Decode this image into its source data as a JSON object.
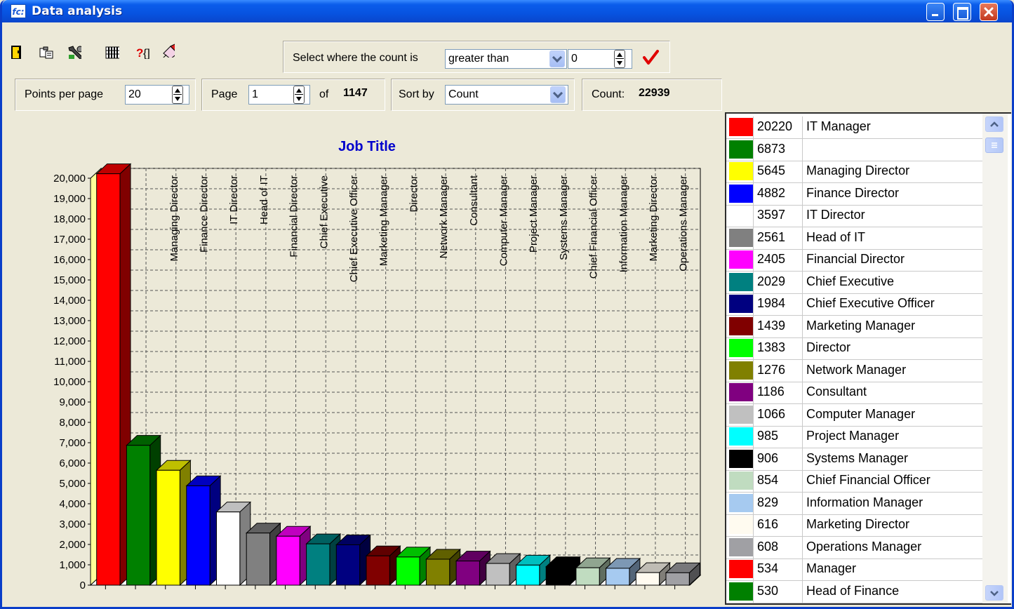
{
  "window": {
    "title": "Data analysis",
    "app_icon_text": "fc:"
  },
  "toolbar": {
    "icons": [
      "exit-icon",
      "copy-icon",
      "tools-icon",
      "grid-icon",
      "query-icon",
      "clear-icon"
    ],
    "select_label": "Select where the count is",
    "condition": "greater than",
    "threshold": "0"
  },
  "controls": {
    "points_per_page_label": "Points per page",
    "points_per_page": "20",
    "page_label": "Page",
    "page": "1",
    "of_label": "of",
    "total_pages": "1147",
    "sort_by_label": "Sort by",
    "sort_by": "Count",
    "count_label": "Count:",
    "count": "22939"
  },
  "chart_data": {
    "type": "bar",
    "title": "Job Title",
    "ylim": [
      0,
      20000
    ],
    "yticks": [
      "0",
      "1,000",
      "2,000",
      "3,000",
      "4,000",
      "5,000",
      "6,000",
      "7,000",
      "8,000",
      "9,000",
      "10,000",
      "11,000",
      "12,000",
      "13,000",
      "14,000",
      "15,000",
      "16,000",
      "17,000",
      "18,000",
      "19,000",
      "20,000"
    ],
    "grid": true,
    "categories": [
      "IT Manager",
      "",
      "Managing Director",
      "Finance Director",
      "IT Director",
      "Head of IT",
      "Financial Director",
      "Chief Executive",
      "Chief Executive Officer",
      "Marketing Manager",
      "Director",
      "Network Manager",
      "Consultant",
      "Computer Manager",
      "Project Manager",
      "Systems Manager",
      "Chief Financial Officer",
      "Information Manager",
      "Marketing Director",
      "Operations Manager"
    ],
    "values": [
      20220,
      6873,
      5645,
      4882,
      3597,
      2561,
      2405,
      2029,
      1984,
      1439,
      1383,
      1276,
      1186,
      1066,
      985,
      906,
      854,
      829,
      616,
      608
    ],
    "colors": [
      "#FF0000",
      "#008000",
      "#FFFF00",
      "#0000FF",
      "#FFFFFF",
      "#808080",
      "#FF00FF",
      "#008080",
      "#000080",
      "#800000",
      "#00FF00",
      "#808000",
      "#800080",
      "#C0C0C0",
      "#00FFFF",
      "#000000",
      "#C0DCC0",
      "#A6CAF0",
      "#FFFBF0",
      "#A0A0A4"
    ]
  },
  "legend": {
    "rows": [
      {
        "count": "20220",
        "name": "IT Manager",
        "color": "#FF0000"
      },
      {
        "count": "6873",
        "name": "",
        "color": "#008000"
      },
      {
        "count": "5645",
        "name": "Managing Director",
        "color": "#FFFF00"
      },
      {
        "count": "4882",
        "name": "Finance Director",
        "color": "#0000FF"
      },
      {
        "count": "3597",
        "name": "IT Director",
        "color": "#FFFFFF"
      },
      {
        "count": "2561",
        "name": "Head of IT",
        "color": "#808080"
      },
      {
        "count": "2405",
        "name": "Financial Director",
        "color": "#FF00FF"
      },
      {
        "count": "2029",
        "name": "Chief Executive",
        "color": "#008080"
      },
      {
        "count": "1984",
        "name": "Chief Executive Officer",
        "color": "#000080"
      },
      {
        "count": "1439",
        "name": "Marketing Manager",
        "color": "#800000"
      },
      {
        "count": "1383",
        "name": "Director",
        "color": "#00FF00"
      },
      {
        "count": "1276",
        "name": "Network Manager",
        "color": "#808000"
      },
      {
        "count": "1186",
        "name": "Consultant",
        "color": "#800080"
      },
      {
        "count": "1066",
        "name": "Computer Manager",
        "color": "#C0C0C0"
      },
      {
        "count": "985",
        "name": "Project Manager",
        "color": "#00FFFF"
      },
      {
        "count": "906",
        "name": "Systems Manager",
        "color": "#000000"
      },
      {
        "count": "854",
        "name": "Chief Financial Officer",
        "color": "#C0DCC0"
      },
      {
        "count": "829",
        "name": "Information Manager",
        "color": "#A6CAF0"
      },
      {
        "count": "616",
        "name": "Marketing Director",
        "color": "#FFFBF0"
      },
      {
        "count": "608",
        "name": "Operations Manager",
        "color": "#A0A0A4"
      },
      {
        "count": "534",
        "name": "Manager",
        "color": "#FF0000"
      },
      {
        "count": "530",
        "name": "Head of Finance",
        "color": "#008000"
      }
    ]
  }
}
